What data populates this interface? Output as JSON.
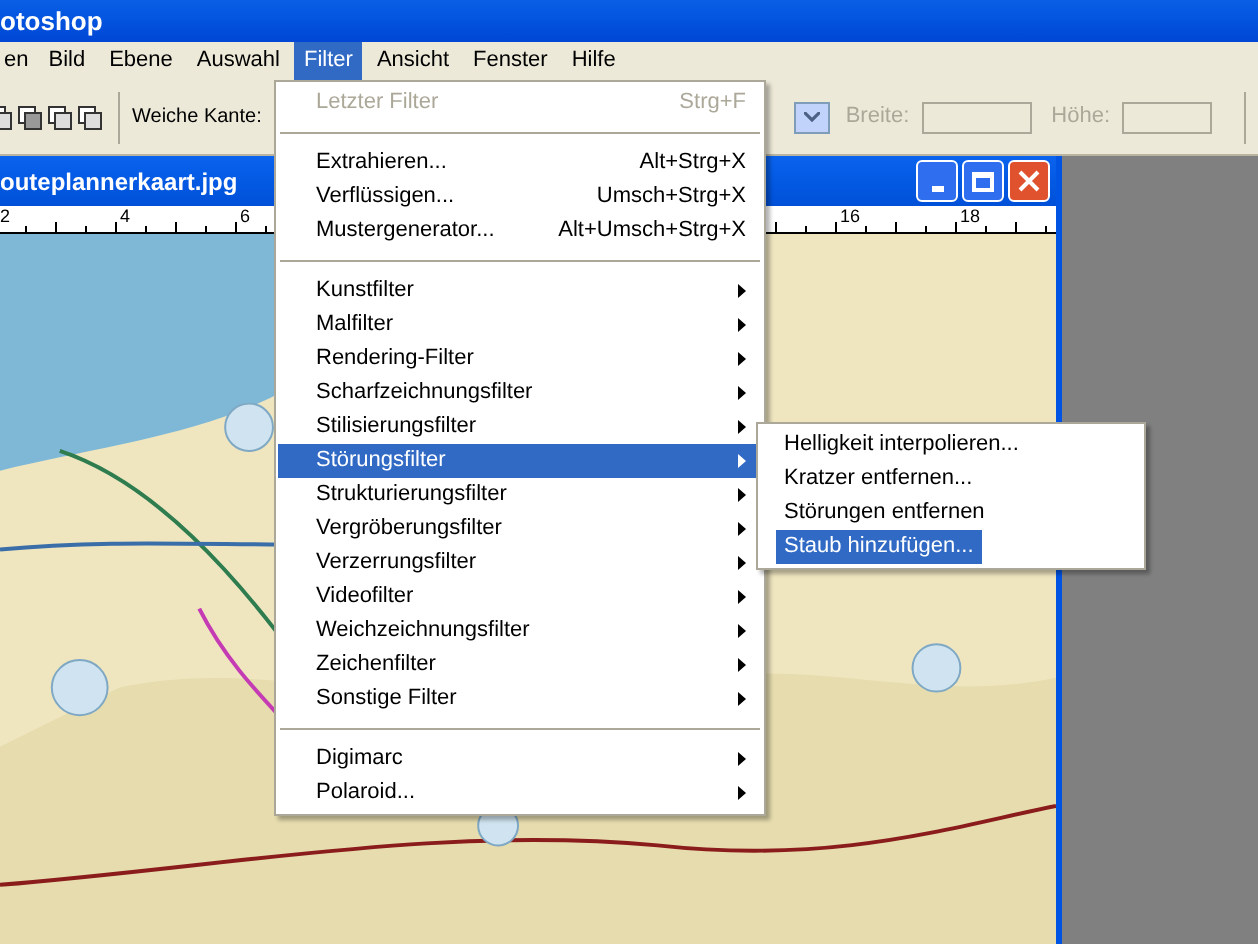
{
  "app_title": "otoshop",
  "menu_bar": [
    {
      "label": "en",
      "selected": false
    },
    {
      "label": "Bild",
      "selected": false
    },
    {
      "label": "Ebene",
      "selected": false
    },
    {
      "label": "Auswahl",
      "selected": false
    },
    {
      "label": "Filter",
      "selected": true
    },
    {
      "label": "Ansicht",
      "selected": false
    },
    {
      "label": "Fenster",
      "selected": false
    },
    {
      "label": "Hilfe",
      "selected": false
    }
  ],
  "options_bar": {
    "feather_label": "Weiche Kante:",
    "width_label": "Breite:",
    "height_label": "Höhe:",
    "size_fields_disabled": true
  },
  "document": {
    "title": "outeplannerkaart.jpg",
    "ruler_labels": [
      "2",
      "4",
      "6",
      "16",
      "18"
    ]
  },
  "filter_menu": [
    {
      "kind": "item",
      "label": "Letzter Filter",
      "shortcut": "Strg+F",
      "disabled": true,
      "selected": false,
      "submenu": false
    },
    {
      "kind": "separator"
    },
    {
      "kind": "item",
      "label": "Extrahieren...",
      "shortcut": "Alt+Strg+X",
      "disabled": false,
      "selected": false,
      "submenu": false
    },
    {
      "kind": "item",
      "label": "Verflüssigen...",
      "shortcut": "Umsch+Strg+X",
      "disabled": false,
      "selected": false,
      "submenu": false
    },
    {
      "kind": "item",
      "label": "Mustergenerator...",
      "shortcut": "Alt+Umsch+Strg+X",
      "disabled": false,
      "selected": false,
      "submenu": false
    },
    {
      "kind": "separator"
    },
    {
      "kind": "item",
      "label": "Kunstfilter",
      "disabled": false,
      "selected": false,
      "submenu": true
    },
    {
      "kind": "item",
      "label": "Malfilter",
      "disabled": false,
      "selected": false,
      "submenu": true
    },
    {
      "kind": "item",
      "label": "Rendering-Filter",
      "disabled": false,
      "selected": false,
      "submenu": true
    },
    {
      "kind": "item",
      "label": "Scharfzeichnungsfilter",
      "disabled": false,
      "selected": false,
      "submenu": true
    },
    {
      "kind": "item",
      "label": "Stilisierungsfilter",
      "disabled": false,
      "selected": false,
      "submenu": true
    },
    {
      "kind": "item",
      "label": "Störungsfilter",
      "disabled": false,
      "selected": true,
      "submenu": true
    },
    {
      "kind": "item",
      "label": "Strukturierungsfilter",
      "disabled": false,
      "selected": false,
      "submenu": true
    },
    {
      "kind": "item",
      "label": "Vergröberungsfilter",
      "disabled": false,
      "selected": false,
      "submenu": true
    },
    {
      "kind": "item",
      "label": "Verzerrungsfilter",
      "disabled": false,
      "selected": false,
      "submenu": true
    },
    {
      "kind": "item",
      "label": "Videofilter",
      "disabled": false,
      "selected": false,
      "submenu": true
    },
    {
      "kind": "item",
      "label": "Weichzeichnungsfilter",
      "disabled": false,
      "selected": false,
      "submenu": true
    },
    {
      "kind": "item",
      "label": "Zeichenfilter",
      "disabled": false,
      "selected": false,
      "submenu": true
    },
    {
      "kind": "item",
      "label": "Sonstige Filter",
      "disabled": false,
      "selected": false,
      "submenu": true
    },
    {
      "kind": "separator"
    },
    {
      "kind": "item",
      "label": "Digimarc",
      "disabled": false,
      "selected": false,
      "submenu": true
    },
    {
      "kind": "item",
      "label": "Polaroid...",
      "disabled": false,
      "selected": false,
      "submenu": true
    }
  ],
  "noise_submenu": [
    {
      "label": "Helligkeit interpolieren...",
      "selected": false
    },
    {
      "label": "Kratzer entfernen...",
      "selected": false
    },
    {
      "label": "Störungen entfernen",
      "selected": false
    },
    {
      "label": "Staub hinzufügen...",
      "selected": true
    }
  ]
}
